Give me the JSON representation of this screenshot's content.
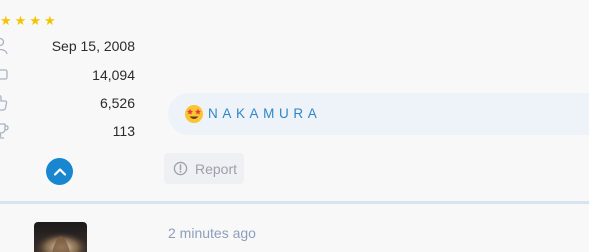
{
  "user_card": {
    "rating_stars": 4,
    "rating_icon": "star-icon",
    "star_color": "#f5c400",
    "stats": [
      {
        "icon": "user-icon",
        "value": "Sep 15, 2008"
      },
      {
        "icon": "message-icon",
        "value": "14,094"
      },
      {
        "icon": "thumbs-up-icon",
        "value": "6,526"
      },
      {
        "icon": "trophy-icon",
        "value": "113"
      }
    ],
    "scroll_up_icon": "chevron-up-icon",
    "accent_color": "#1887cf"
  },
  "signature": {
    "emoji": "star-struck-emoji",
    "text": "NAKAMURA",
    "color": "#2f86c6"
  },
  "actions": {
    "report_label": "Report",
    "report_icon": "alert-circle-icon"
  },
  "next_post": {
    "timestamp": "2 minutes ago"
  }
}
